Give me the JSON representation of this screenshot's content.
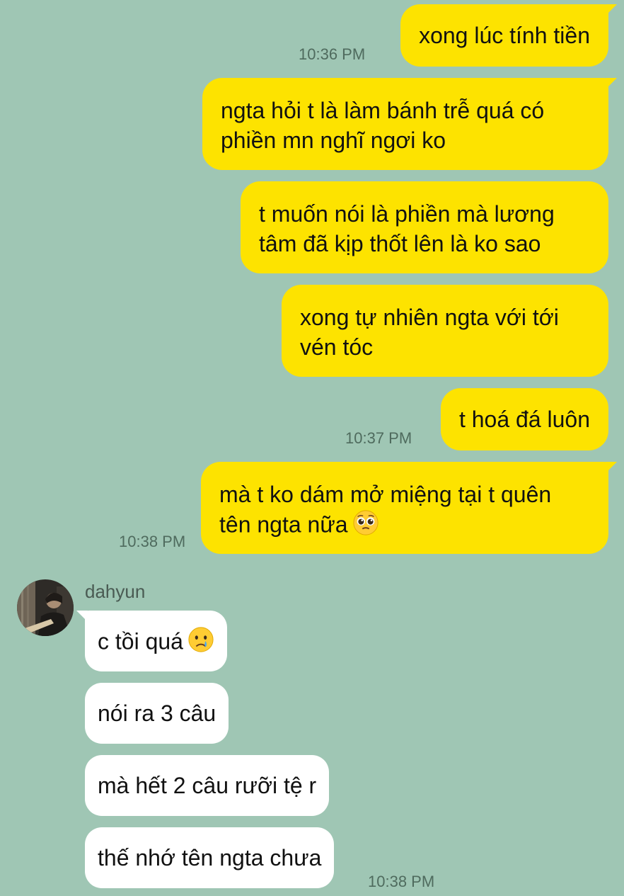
{
  "messages_out": [
    {
      "text": "xong lúc tính tiền",
      "time": "10:36 PM"
    },
    {
      "line1": "ngta hỏi t là làm bánh trễ quá có",
      "line2": "phiền mn nghĩ ngơi ko"
    },
    {
      "line1": "t muốn nói là phiền mà lương",
      "line2": "tâm đã kịp thốt lên là ko sao"
    },
    {
      "line1": "xong tự nhiên ngta với tới",
      "line2": "vén tóc"
    },
    {
      "text": "t hoá đá luôn",
      "time": "10:37 PM"
    },
    {
      "line1": "mà t ko dám mở miệng tại t quên",
      "line2": "tên ngta nữa",
      "emoji": "pleading-face",
      "time": "10:38 PM"
    }
  ],
  "contact": {
    "name": "dahyun",
    "avatar": "avatar-photo"
  },
  "messages_in": [
    {
      "text": "c tồi quá",
      "emoji": "crying-face"
    },
    {
      "text": "nói ra 3 câu"
    },
    {
      "text": "mà hết 2 câu rưỡi tệ r"
    },
    {
      "text": "thế nhớ tên ngta chưa",
      "time": "10:38 PM"
    }
  ],
  "colors": {
    "background": "#9fc6b4",
    "outgoing_bubble": "#fde300",
    "incoming_bubble": "#ffffff"
  }
}
